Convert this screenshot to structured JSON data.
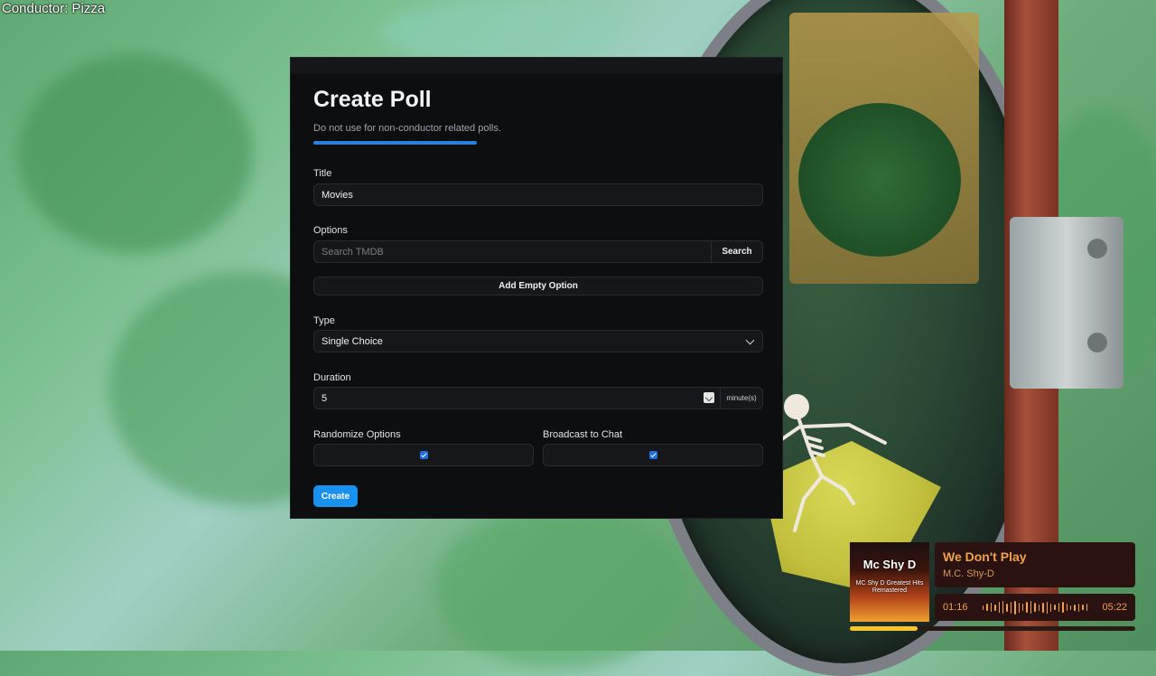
{
  "overlay": {
    "conductor_label": "Conductor: Pizza"
  },
  "poll": {
    "title": "Create Poll",
    "subtitle": "Do not use for non-conductor related polls.",
    "title_field": {
      "label": "Title",
      "value": "Movies"
    },
    "options_field": {
      "label": "Options",
      "placeholder": "Search TMDB",
      "search_label": "Search",
      "add_empty_label": "Add Empty Option"
    },
    "type_field": {
      "label": "Type",
      "selected": "Single Choice"
    },
    "duration_field": {
      "label": "Duration",
      "value": "5",
      "unit": "minute(s)"
    },
    "randomize": {
      "label": "Randomize Options",
      "checked": true
    },
    "broadcast": {
      "label": "Broadcast to Chat",
      "checked": true
    },
    "create_label": "Create",
    "accent": "#1992ef"
  },
  "music": {
    "album_title": "Mc Shy D",
    "album_subtitle": "MC Shy D Greatest Hits Remastered",
    "track_title": "We Don't Play",
    "artist": "M.C. Shy-D",
    "elapsed": "01:16",
    "duration": "05:22",
    "progress": 0.236,
    "accent": "#f0a34c"
  }
}
